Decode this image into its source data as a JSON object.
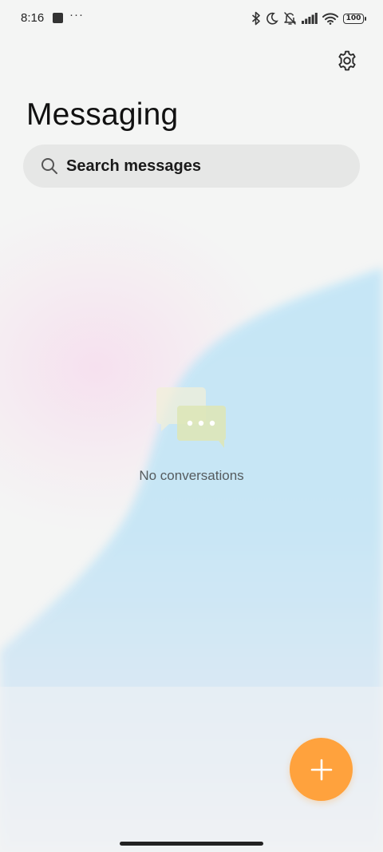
{
  "status_bar": {
    "time": "8:16",
    "more_indicator": "···",
    "battery_level": "100",
    "icons": [
      "bluetooth-icon",
      "moon-icon",
      "bell-off-icon",
      "signal-icon",
      "wifi-icon",
      "battery-icon"
    ]
  },
  "header": {
    "title": "Messaging",
    "settings_icon": "gear-icon"
  },
  "search": {
    "placeholder": "Search messages",
    "icon": "search-icon"
  },
  "empty_state": {
    "text": "No conversations",
    "icon": "chat-bubbles-icon"
  },
  "fab": {
    "icon": "plus-icon",
    "color": "#ffa23d"
  }
}
